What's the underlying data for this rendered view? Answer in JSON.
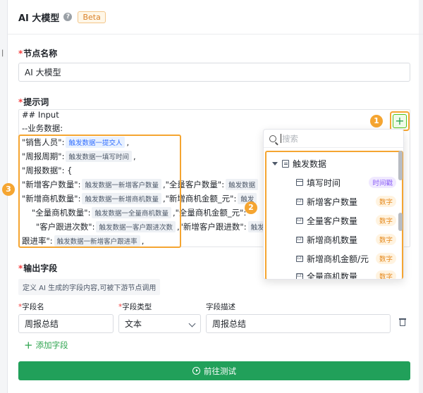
{
  "header": {
    "title": "AI 大模型",
    "beta": "Beta"
  },
  "node_name": {
    "label": "节点名称",
    "value": "AI 大模型"
  },
  "prompt": {
    "label": "提示词",
    "lines": {
      "l1": "## Input",
      "l2": "--业务数据:",
      "l3a": "\"销售人员\":",
      "l3t": "触发数据一提交人",
      "l3b": ",",
      "l4a": "\"周报周期\":",
      "l4t": "触发数据一填写时间",
      "l4b": ",",
      "l5": "\"周报数据\": {",
      "l6a": "\"新增客户数量\":",
      "l6t": "触发数据一新增客户数量",
      "l6b": ",\"全量客户数量\":",
      "l6t2": "触发数据",
      "l7a": "\"新增商机数量\":",
      "l7t": "触发数据一新增商机数量",
      "l7b": ",\"新增商机金额_元\":",
      "l7t2": "触发",
      "l8a": "\"全量商机数量\":",
      "l8t": "触发数据一全量商机数量",
      "l8b": ",\"全量商机金额_元\":",
      "l9a": "\"客户跟进次数\":",
      "l9t": "触发数据一客户跟进次数",
      "l9b": ",\"新增客户跟进数\":",
      "l9t2": "触发",
      "l10a": "跟进率\":",
      "l10t": "触发数据一新增客户跟进率",
      "l10b": ","
    }
  },
  "badges": {
    "b1": "1",
    "b2": "2",
    "b3": "3"
  },
  "variable_picker": {
    "search_placeholder": "搜索",
    "group": "触发数据",
    "items": [
      {
        "label": "填写时间",
        "type": "时间戳"
      },
      {
        "label": "新增客户数量",
        "type": "数字"
      },
      {
        "label": "全量客户数量",
        "type": "数字"
      },
      {
        "label": "新增商机数量",
        "type": "数字"
      },
      {
        "label": "新增商机金额/元",
        "type": "数字"
      },
      {
        "label": "全量商机数量",
        "type": "数字"
      }
    ]
  },
  "output": {
    "label": "输出字段",
    "hint": "定义 AI 生成的字段内容,可被下游节点调用",
    "col_name": "字段名",
    "col_type": "字段类型",
    "col_desc": "字段描述",
    "field_name": "周报总结",
    "field_type": "文本",
    "field_desc": "周报总结",
    "add_field": "添加字段"
  },
  "run_button": "前往测试",
  "colors": {
    "accent_green": "#21a05a",
    "highlight_orange": "#f5a531"
  }
}
